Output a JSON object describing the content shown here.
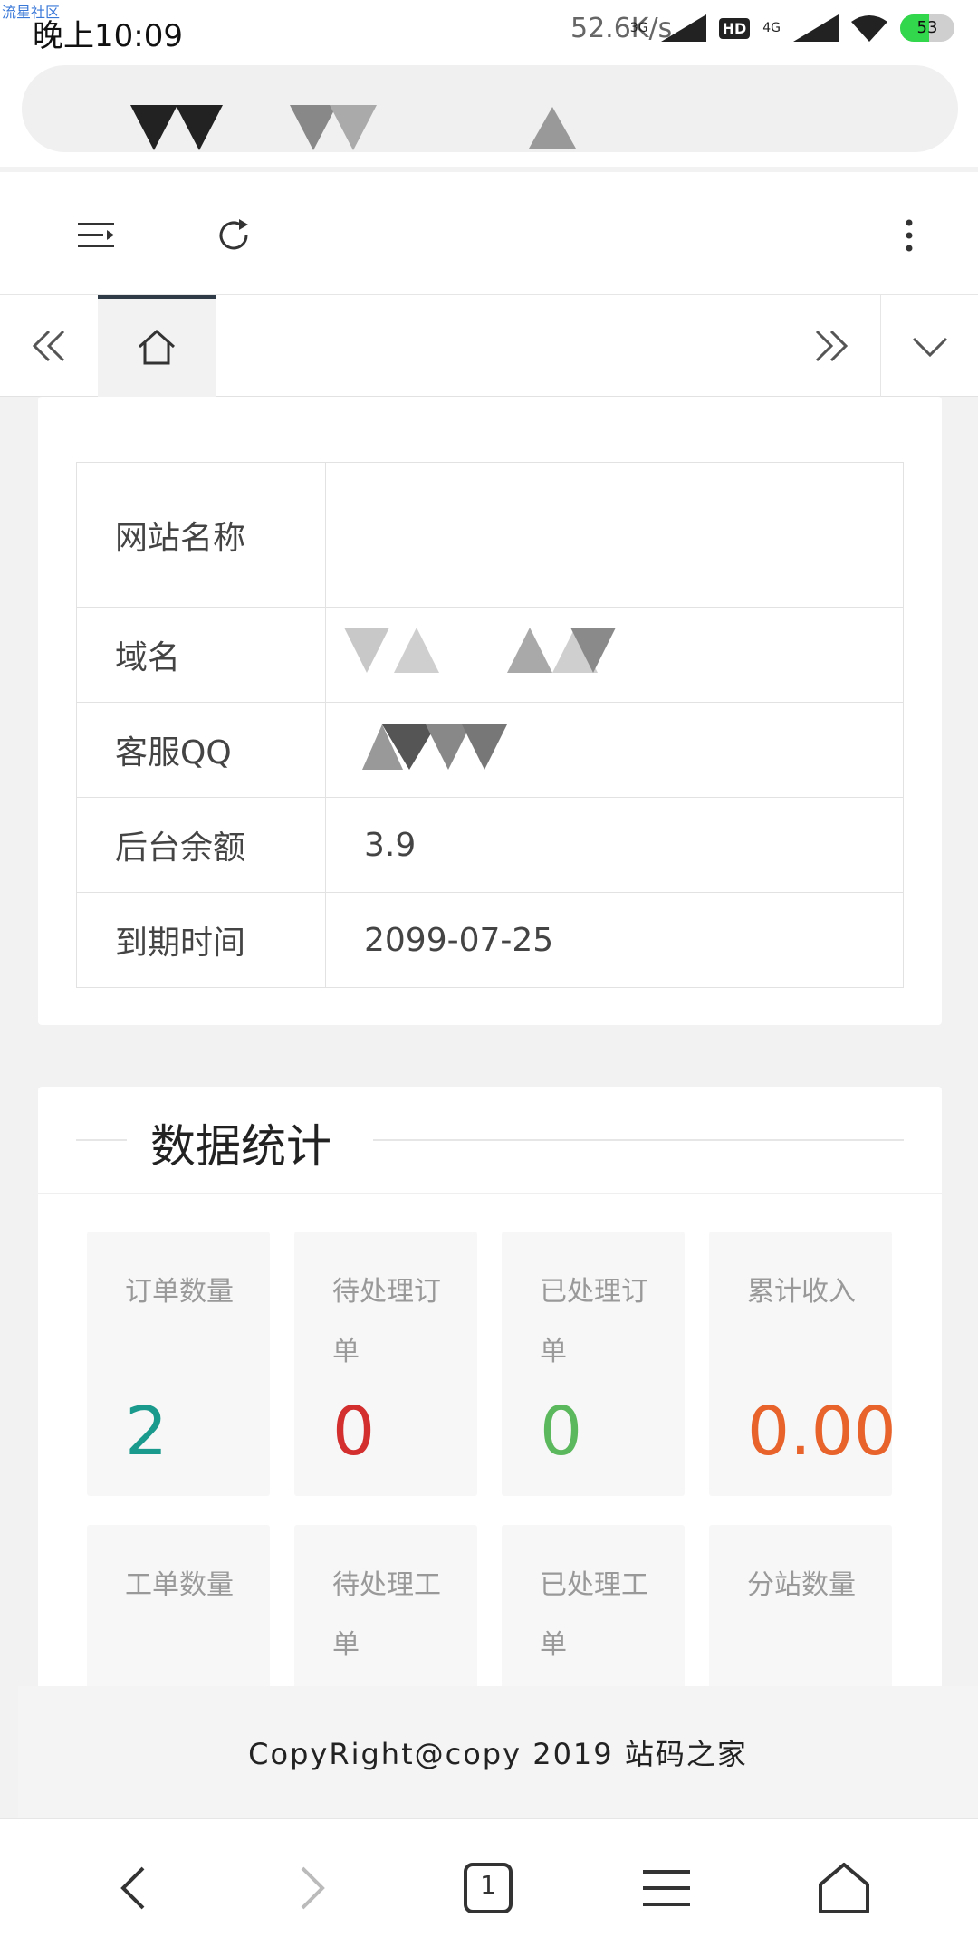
{
  "status_bar": {
    "watermark": "流星社区",
    "time": "晚上10:09",
    "speed": "52.6K/s",
    "sig1": "3G",
    "hd": "HD",
    "sig2": "4G",
    "battery": "53",
    "battery_level": 0.53,
    "battery_color": "#32d74b"
  },
  "toolbar": {
    "menu_icon": "menu-icon",
    "refresh_icon": "refresh-icon",
    "more_icon": "more-vertical-icon"
  },
  "tabs": {
    "home_icon": "home-icon",
    "accent": "#2f3b47"
  },
  "site_info": {
    "rows": [
      {
        "key": "网站名称",
        "value": ""
      },
      {
        "key": "域名",
        "value": ""
      },
      {
        "key": "客服QQ",
        "value": ""
      },
      {
        "key": "后台余额",
        "value": "3.9"
      },
      {
        "key": "到期时间",
        "value": "2099-07-25"
      }
    ]
  },
  "stats": {
    "title": "数据统计",
    "cards": [
      {
        "label": "订单数量",
        "value": "2",
        "color": "#1a9a8c"
      },
      {
        "label": "待处理订单",
        "value": "0",
        "color": "#d32f2f"
      },
      {
        "label": "已处理订单",
        "value": "0",
        "color": "#5cb85c"
      },
      {
        "label": "累计收入",
        "value": "0.00",
        "color": "#e8622b"
      },
      {
        "label": "工单数量",
        "value": ""
      },
      {
        "label": "待处理工单",
        "value": ""
      },
      {
        "label": "已处理工单",
        "value": ""
      },
      {
        "label": "分站数量",
        "value": ""
      }
    ]
  },
  "footer": {
    "text": "CopyRight@copy 2019 站码之家"
  },
  "bottom_nav": {
    "tab_count": "1"
  }
}
